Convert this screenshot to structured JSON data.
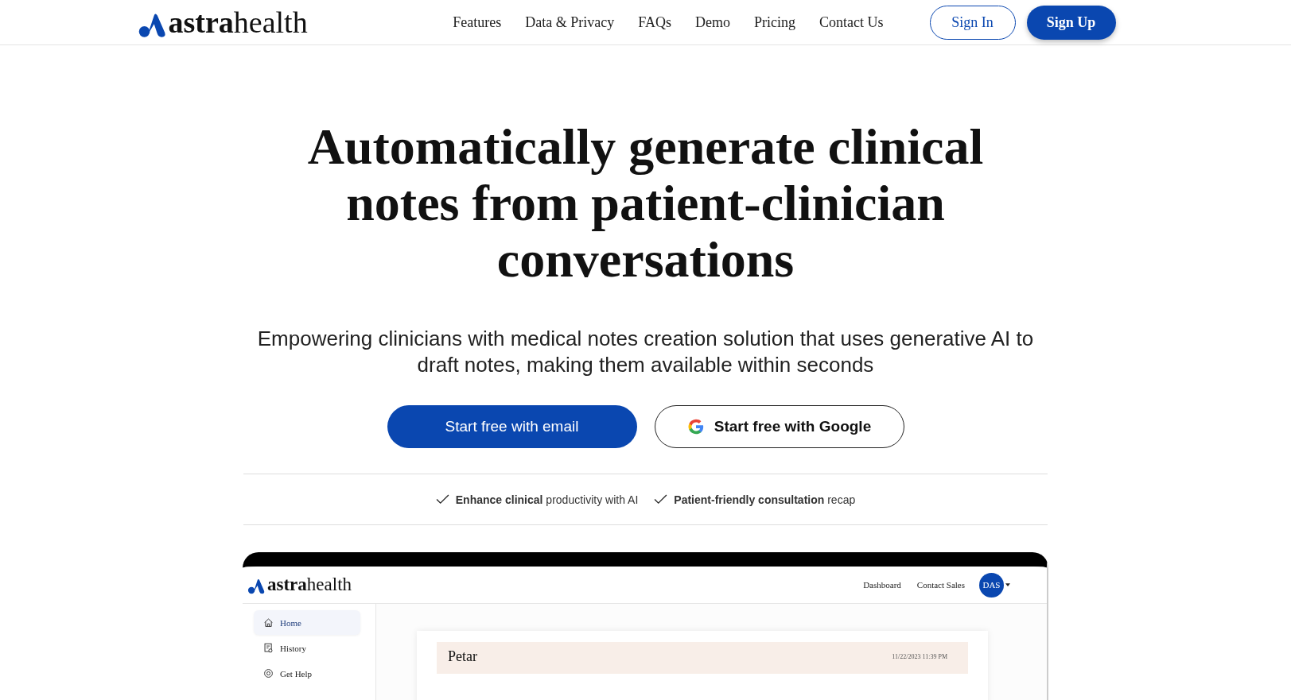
{
  "header": {
    "logo": "**astra**health",
    "nav": [
      {
        "label": "Features"
      },
      {
        "label": "Data & Privacy"
      },
      {
        "label": "FAQs"
      },
      {
        "label": "Demo"
      },
      {
        "label": "Pricing"
      },
      {
        "label": "Contact Us"
      }
    ],
    "sign_in": "Sign In",
    "sign_up": "Sign Up"
  },
  "hero": {
    "title": "Automatically generate clinical notes from patient-clinician conversations",
    "subtitle": "Empowering clinicians with medical notes creation solution that uses generative AI to draft notes, making them available within seconds",
    "buttons": [
      {
        "kind": "primary",
        "label": "Start free with email"
      },
      {
        "kind": "google",
        "label": "Start free with Google"
      }
    ],
    "features": [
      "**Enhance clinical** productivity with AI",
      "**Patient-friendly consultation** recap"
    ]
  },
  "preview": {
    "logo": "**astra**health",
    "nav": [
      "Dashboard",
      "Contact Sales"
    ],
    "avatar": "DAS",
    "sidebar": [
      {
        "label": "Home",
        "selected": true
      },
      {
        "label": "History",
        "selected": false
      },
      {
        "label": "Get Help",
        "selected": false
      }
    ],
    "note": {
      "name": "Petar",
      "date": "11/22/2023 11:39 PM"
    }
  }
}
